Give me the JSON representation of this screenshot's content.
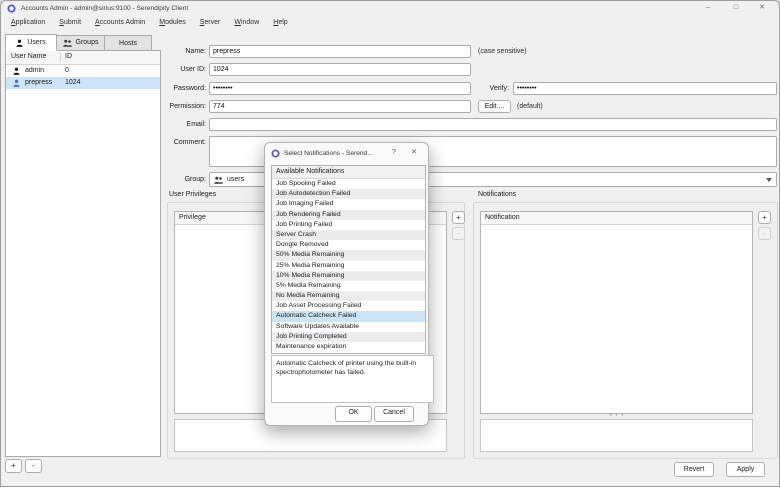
{
  "window": {
    "title": "Accounts Admin - admin@sirius:9100 - Serendipity Client",
    "controls": {
      "minimize": "–",
      "maximize": "□",
      "close": "✕"
    }
  },
  "menu": {
    "items": [
      "Application",
      "Submit",
      "Accounts Admin",
      "Modules",
      "Server",
      "Window",
      "Help"
    ]
  },
  "sidebar": {
    "tabs": [
      {
        "label": "Users"
      },
      {
        "label": "Groups"
      },
      {
        "label": "Hosts"
      }
    ],
    "table": {
      "columns": [
        "User Name",
        "ID"
      ],
      "rows": [
        {
          "name": "admin",
          "id": "0",
          "selected": false
        },
        {
          "name": "prepress",
          "id": "1024",
          "selected": true
        }
      ]
    },
    "add_label": "+",
    "remove_label": "-"
  },
  "form": {
    "name": {
      "label": "Name:",
      "value": "prepress",
      "note": "(case sensitive)"
    },
    "user_id": {
      "label": "User ID:",
      "value": "1024"
    },
    "password": {
      "label": "Password:",
      "value": "••••••••"
    },
    "verify": {
      "label": "Verify:",
      "value": "••••••••"
    },
    "permission": {
      "label": "Permission:",
      "value": "774",
      "edit_button": "Edit ...",
      "note": "(default)"
    },
    "email": {
      "label": "Email:",
      "value": ""
    },
    "comment": {
      "label": "Comment:",
      "value": ""
    },
    "group": {
      "label": "Group:",
      "value": "users"
    }
  },
  "privileges": {
    "title": "User Privileges",
    "column": "Privilege",
    "add_label": "+",
    "remove_label": "-",
    "rows": []
  },
  "notifications": {
    "title": "Notifications",
    "column": "Notification",
    "add_label": "+",
    "remove_label": "-",
    "rows": []
  },
  "footer": {
    "revert": "Revert",
    "apply": "Apply"
  },
  "dialog": {
    "title": "Select Notifications - Serend...",
    "help": "?",
    "close": "✕",
    "list_header": "Available Notifications",
    "items": [
      "Job Spooling Failed",
      "Job Autodetection Failed",
      "Job Imaging Failed",
      "Job Rendering Failed",
      "Job Printing Failed",
      "Server Crash",
      "Dongle Removed",
      "50% Media Remaining",
      "25% Media Remaining",
      "10% Media Remaining",
      "5% Media Remaining",
      "No Media Remaining",
      "Job Asset Processing Failed",
      "Automatic Calcheck Failed",
      "Software Updates Available",
      "Job Printing Completed",
      "Maintenance expiration"
    ],
    "selected_item": "Automatic Calcheck Failed",
    "description": "Automatic Calcheck of printer using the built-in spectrophotometer has failed.",
    "ok": "OK",
    "cancel": "Cancel"
  },
  "colors": {
    "selection_blue": "#cce4f7",
    "dialog_selection_blue": "#cde4f7",
    "app_icon_blue": "#4553c9",
    "user_icon_blue": "#3a6fc4",
    "window_bg": "#f0f0f0"
  }
}
